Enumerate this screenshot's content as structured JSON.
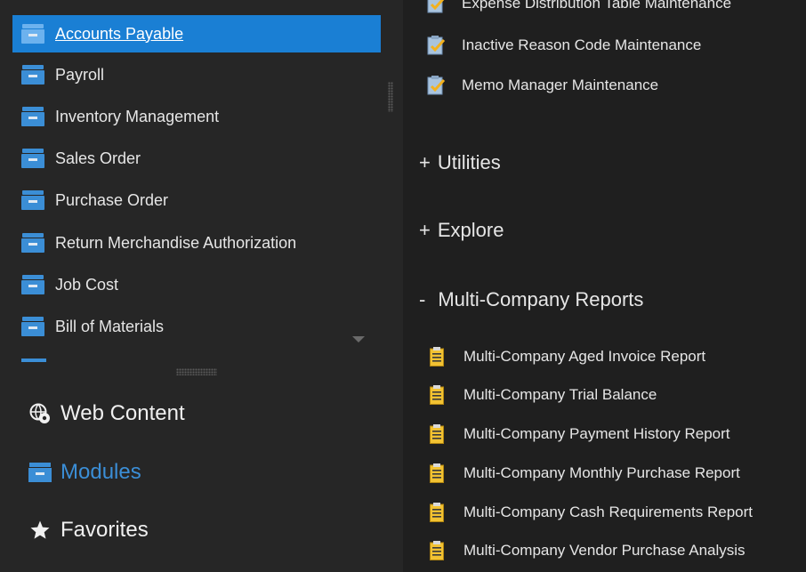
{
  "modules": {
    "items": [
      {
        "label": "Accounts Payable",
        "selected": true
      },
      {
        "label": "Payroll",
        "selected": false
      },
      {
        "label": "Inventory Management",
        "selected": false
      },
      {
        "label": "Sales Order",
        "selected": false
      },
      {
        "label": "Purchase Order",
        "selected": false
      },
      {
        "label": "Return Merchandise Authorization",
        "selected": false
      },
      {
        "label": "Job Cost",
        "selected": false
      },
      {
        "label": "Bill of Materials",
        "selected": false
      }
    ]
  },
  "nav": {
    "web_content": {
      "label": "Web Content",
      "icon": "globe-gear-icon"
    },
    "modules": {
      "label": "Modules",
      "icon": "module-icon",
      "active": true
    },
    "favorites": {
      "label": "Favorites",
      "icon": "star-icon"
    }
  },
  "tasks": {
    "maintenance": [
      {
        "label": "Expense Distribution Table Maintenance",
        "icon": "clipboard-check-icon"
      },
      {
        "label": "Inactive Reason Code Maintenance",
        "icon": "clipboard-check-icon"
      },
      {
        "label": "Memo Manager Maintenance",
        "icon": "clipboard-check-icon"
      }
    ],
    "groups": [
      {
        "mark": "+",
        "label": "Utilities",
        "expanded": false
      },
      {
        "mark": "+",
        "label": "Explore",
        "expanded": false
      },
      {
        "mark": "-",
        "label": "Multi-Company Reports",
        "expanded": true
      }
    ],
    "reports": [
      {
        "label": "Multi-Company Aged Invoice Report",
        "icon": "report-icon"
      },
      {
        "label": "Multi-Company Trial Balance",
        "icon": "report-icon"
      },
      {
        "label": "Multi-Company Payment History Report",
        "icon": "report-icon"
      },
      {
        "label": "Multi-Company Monthly Purchase Report",
        "icon": "report-icon"
      },
      {
        "label": "Multi-Company Cash Requirements Report",
        "icon": "report-icon"
      },
      {
        "label": "Multi-Company Vendor Purchase Analysis",
        "icon": "report-icon"
      }
    ]
  },
  "colors": {
    "accent": "#1a7fd4",
    "module_blue": "#3b8ed6",
    "report_yellow": "#f2c232",
    "background": "#262626",
    "panel": "#1f1f1f"
  }
}
